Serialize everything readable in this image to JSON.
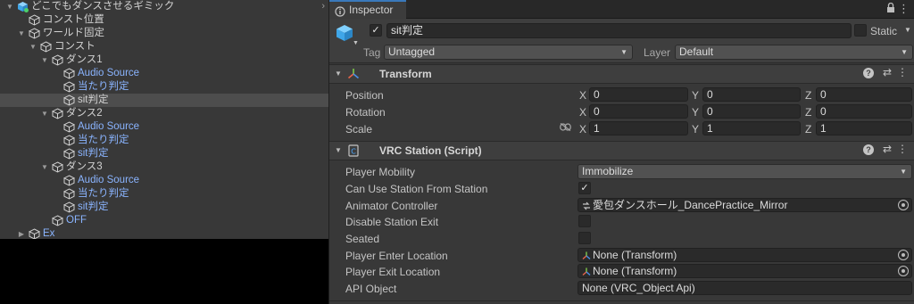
{
  "hierarchy": {
    "rows": [
      {
        "label": "どこでもダンスさせるギミック",
        "color": "white",
        "arrow": "down",
        "depth": 0,
        "icon": "prefab-cube-icon"
      },
      {
        "label": "コンスト位置",
        "color": "white",
        "arrow": "none",
        "depth": 1,
        "icon": "cube-icon"
      },
      {
        "label": "ワールド固定",
        "color": "white",
        "arrow": "down",
        "depth": 1,
        "icon": "cube-icon"
      },
      {
        "label": "コンスト",
        "color": "white",
        "arrow": "down",
        "depth": 2,
        "icon": "cube-icon"
      },
      {
        "label": "ダンス1",
        "color": "white",
        "arrow": "down",
        "depth": 3,
        "icon": "cube-icon"
      },
      {
        "label": "Audio Source",
        "color": "blue",
        "arrow": "none",
        "depth": 4,
        "icon": "cube-icon"
      },
      {
        "label": "当たり判定",
        "color": "blue",
        "arrow": "none",
        "depth": 4,
        "icon": "cube-icon"
      },
      {
        "label": "sit判定",
        "color": "white",
        "arrow": "none",
        "depth": 4,
        "icon": "cube-icon",
        "selected": true
      },
      {
        "label": "ダンス2",
        "color": "white",
        "arrow": "down",
        "depth": 3,
        "icon": "cube-icon"
      },
      {
        "label": "Audio Source",
        "color": "blue",
        "arrow": "none",
        "depth": 4,
        "icon": "cube-icon"
      },
      {
        "label": "当たり判定",
        "color": "blue",
        "arrow": "none",
        "depth": 4,
        "icon": "cube-icon"
      },
      {
        "label": "sit判定",
        "color": "blue",
        "arrow": "none",
        "depth": 4,
        "icon": "cube-icon"
      },
      {
        "label": "ダンス3",
        "color": "white",
        "arrow": "down",
        "depth": 3,
        "icon": "cube-icon"
      },
      {
        "label": "Audio Source",
        "color": "blue",
        "arrow": "none",
        "depth": 4,
        "icon": "cube-icon"
      },
      {
        "label": "当たり判定",
        "color": "blue",
        "arrow": "none",
        "depth": 4,
        "icon": "cube-icon"
      },
      {
        "label": "sit判定",
        "color": "blue",
        "arrow": "none",
        "depth": 4,
        "icon": "cube-icon"
      },
      {
        "label": "OFF",
        "color": "blue",
        "arrow": "none",
        "depth": 3,
        "icon": "cube-icon"
      },
      {
        "label": "Ex",
        "color": "blue",
        "arrow": "right",
        "depth": 1,
        "icon": "cube-icon"
      }
    ]
  },
  "inspector": {
    "tab_label": "Inspector",
    "header": {
      "active": true,
      "name": "sit判定",
      "static_label": "Static",
      "static": false,
      "tag_label": "Tag",
      "tag_value": "Untagged",
      "layer_label": "Layer",
      "layer_value": "Default"
    },
    "transform": {
      "title": "Transform",
      "position": {
        "label": "Position",
        "x": "0",
        "y": "0",
        "z": "0"
      },
      "rotation": {
        "label": "Rotation",
        "x": "0",
        "y": "0",
        "z": "0"
      },
      "scale": {
        "label": "Scale",
        "x": "1",
        "y": "1",
        "z": "1"
      },
      "axis_x": "X",
      "axis_y": "Y",
      "axis_z": "Z"
    },
    "station": {
      "title": "VRC Station (Script)",
      "player_mobility_label": "Player Mobility",
      "player_mobility_value": "Immobilize",
      "can_use_label": "Can Use Station From Station",
      "can_use": true,
      "animator_label": "Animator Controller",
      "animator_value": "愛包ダンスホール_DancePractice_Mirror",
      "disable_exit_label": "Disable Station Exit",
      "disable_exit": false,
      "seated_label": "Seated",
      "seated": false,
      "enter_label": "Player Enter Location",
      "enter_value": "None (Transform)",
      "exit_label": "Player Exit Location",
      "exit_value": "None (Transform)",
      "api_label": "API Object",
      "api_value": "None (VRC_Object Api)"
    }
  },
  "colors": {
    "panel": "#383838",
    "field": "#2a2a2a",
    "accent_tab": "#3a79bb",
    "hierarchy_blue_text": "#8ab4ff",
    "selection": "#4d4d4d"
  }
}
